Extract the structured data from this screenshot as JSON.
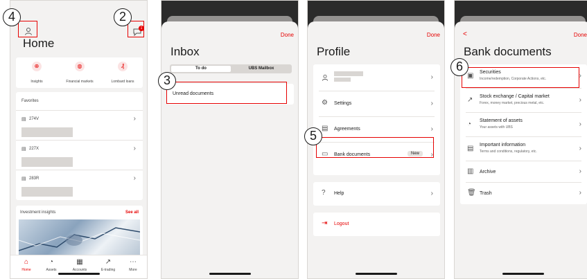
{
  "screen1": {
    "title": "Home",
    "callout_4": "4",
    "callout_2": "2",
    "notif_count": "1",
    "quick_links": [
      "Insights",
      "Financial markets",
      "Lombard loans"
    ],
    "favorites_header": "Favorites",
    "favorites": [
      "274V",
      "227X",
      "283R"
    ],
    "insights_header": "Investment insights",
    "see_all": "See all",
    "tabs": [
      "Home",
      "Assets",
      "Accounts",
      "E-trading",
      "More"
    ]
  },
  "screen2": {
    "done": "Done",
    "title": "Inbox",
    "seg_todo": "To do",
    "seg_mailbox": "UBS Mailbox",
    "callout_3": "3",
    "item": "Unread documents"
  },
  "screen3": {
    "done": "Done",
    "title": "Profile",
    "settings": "Settings",
    "agreements": "Agreements",
    "bank_documents": "Bank documents",
    "new_badge": "New",
    "callout_5": "5",
    "help": "Help",
    "logout": "Logout"
  },
  "screen4": {
    "done": "Done",
    "back": "<",
    "title": "Bank documents",
    "callout_6": "6",
    "items": [
      {
        "label": "Securities",
        "sub": "Income/redemption, Corporate Actions, etc."
      },
      {
        "label": "Stock exchange / Capital market",
        "sub": "Forex, money market, precious metal, etc."
      },
      {
        "label": "Statement of assets",
        "sub": "Your assets with UBS"
      },
      {
        "label": "Important information",
        "sub": "Terms and conditions, regulatory, etc."
      },
      {
        "label": "Archive",
        "sub": ""
      },
      {
        "label": "Trash",
        "sub": ""
      }
    ]
  },
  "icons": {
    "profile": "person-icon",
    "notification": "chat-bubble-icon",
    "chevron": "chevron-right-icon",
    "accent": "#e60000"
  }
}
